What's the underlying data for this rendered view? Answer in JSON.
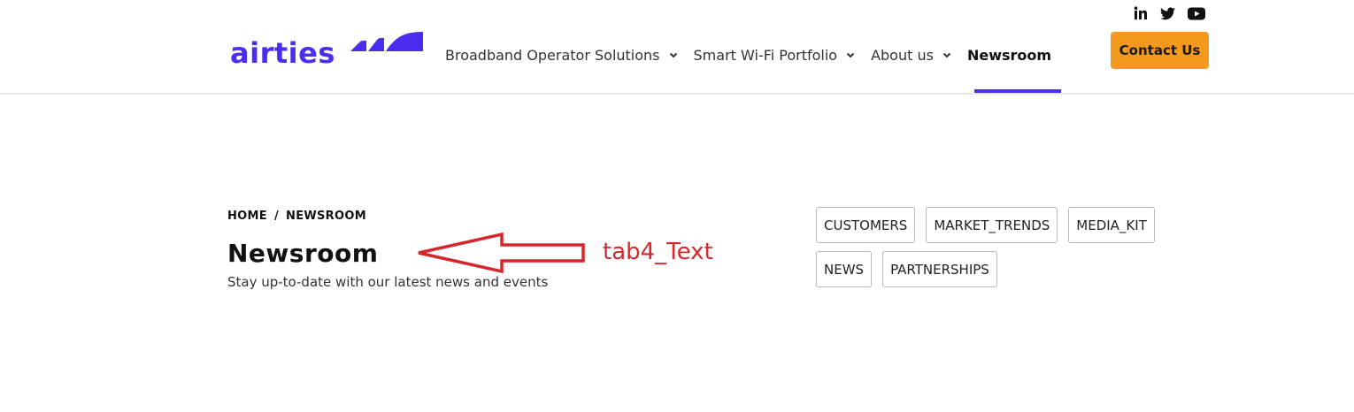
{
  "brand": {
    "logo_text": "airties",
    "accent_color": "#4a2ef0",
    "contact_color": "#f39a1e"
  },
  "social": {
    "icons": [
      "linkedin-icon",
      "twitter-icon",
      "youtube-icon"
    ]
  },
  "nav": {
    "items": [
      {
        "label": "Broadband Operator Solutions",
        "has_dropdown": true
      },
      {
        "label": "Smart Wi-Fi Portfolio",
        "has_dropdown": true
      },
      {
        "label": "About us",
        "has_dropdown": true
      },
      {
        "label": "Newsroom",
        "has_dropdown": false,
        "active": true
      }
    ],
    "contact_label": "Contact Us"
  },
  "breadcrumb": {
    "home": "HOME",
    "separator": "/",
    "current": "NEWSROOM"
  },
  "main": {
    "title": "Newsroom",
    "subtitle": "Stay up-to-date with our latest news and events"
  },
  "annotation": {
    "label": "tab4_Text",
    "color": "#d6262c"
  },
  "tags": {
    "row1": [
      "CUSTOMERS",
      "MARKET_TRENDS",
      "MEDIA_KIT"
    ],
    "row2": [
      "NEWS",
      "PARTNERSHIPS"
    ]
  }
}
